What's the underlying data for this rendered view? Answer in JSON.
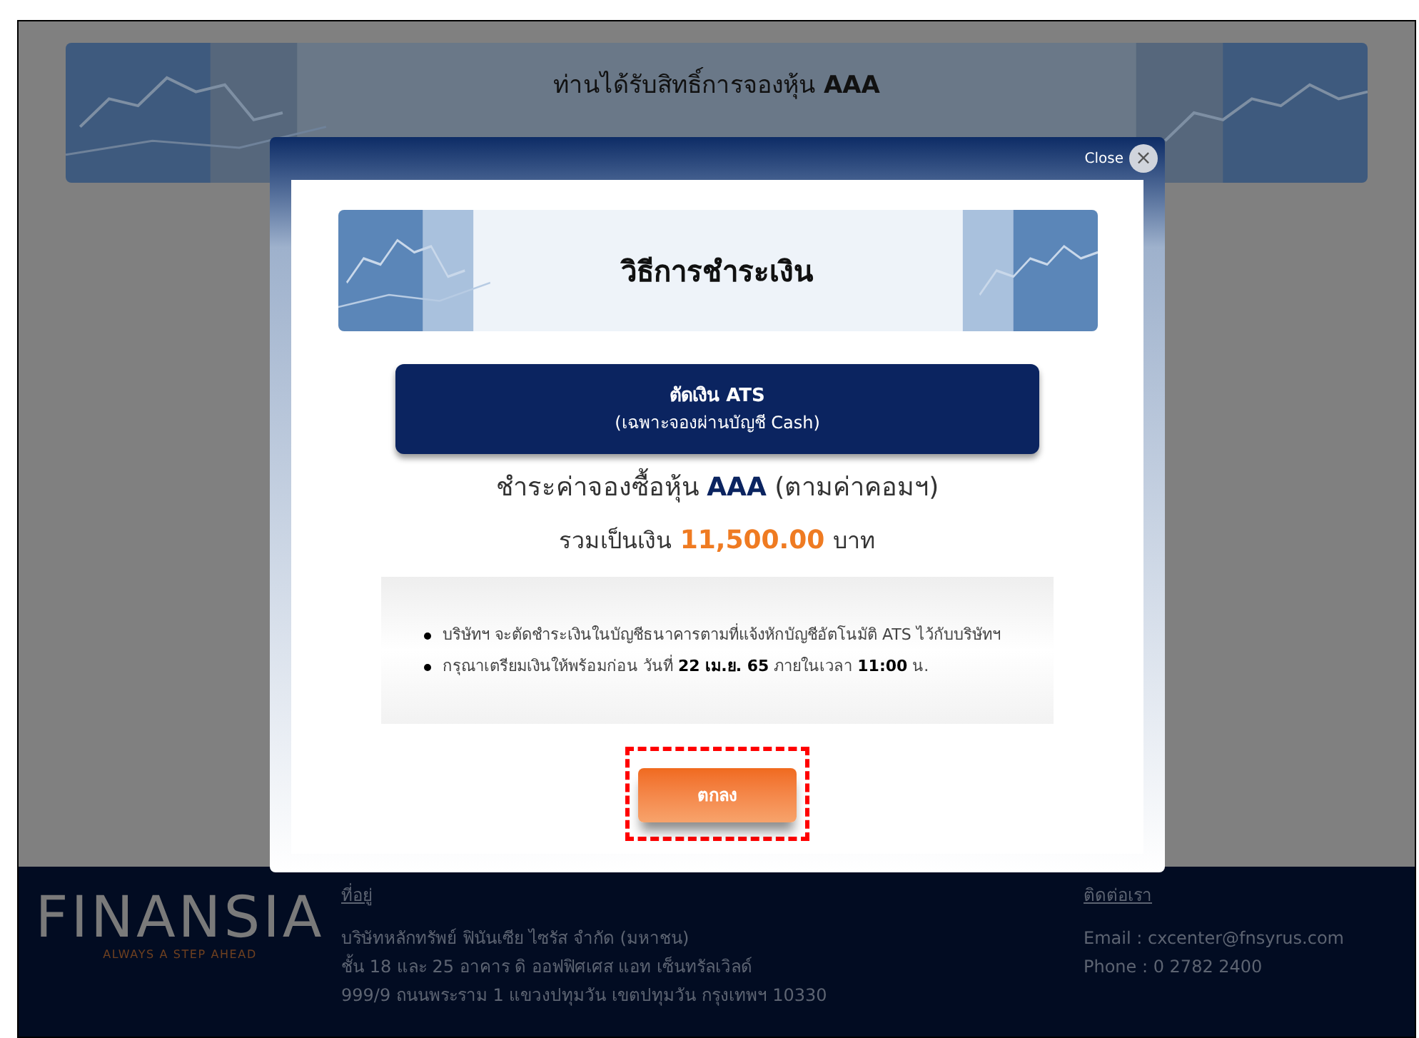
{
  "banner": {
    "text": "ท่านได้รับสิทธิ์การจองหุ้น **AAA**"
  },
  "modal": {
    "close_label": "Close",
    "close_icon": "×",
    "title": "วิธีการชำระเงิน",
    "method": {
      "title": "ตัดเงิน ATS",
      "subtitle": "(เฉพาะจองผ่านบัญชี Cash)"
    },
    "summary": "ชำระค่าจองซื้อหุ้น **AAA** (ตามค่าคอมฯ)",
    "total": {
      "label": "รวมเป็นเงิน",
      "amount": "11,500.00",
      "unit": "บาท"
    },
    "notes": [
      "บริษัทฯ จะตัดชำระเงินในบัญชีธนาคารตามที่แจ้งหักบัญชีอัตโนมัติ ATS ไว้กับบริษัทฯ",
      "กรุณาเตรียมเงินให้พร้อมก่อน วันที่ **22 เม.ย. 65** ภายในเวลา **11:00** น."
    ],
    "confirm_button": "ตกลง",
    "highlighted": true
  },
  "footer": {
    "logo": "FINANSIA",
    "tagline": "ALWAYS A STEP AHEAD",
    "address": {
      "heading": "ที่อยู่",
      "lines": [
        "บริษัทหลักทรัพย์ ฟินันเซีย ไซรัส จำกัด (มหาชน)",
        "ชั้น 18 และ 25 อาคาร ดิ ออฟฟิศเศส แอท เซ็นทรัลเวิลด์",
        "999/9 ถนนพระราม 1 แขวงปทุมวัน เขตปทุมวัน กรุงเทพฯ 10330"
      ]
    },
    "contact": {
      "heading": "ติดต่อเรา",
      "lines": [
        "Email : cxcenter@fnsyrus.com",
        "Phone : 0 2782 2400"
      ]
    }
  }
}
